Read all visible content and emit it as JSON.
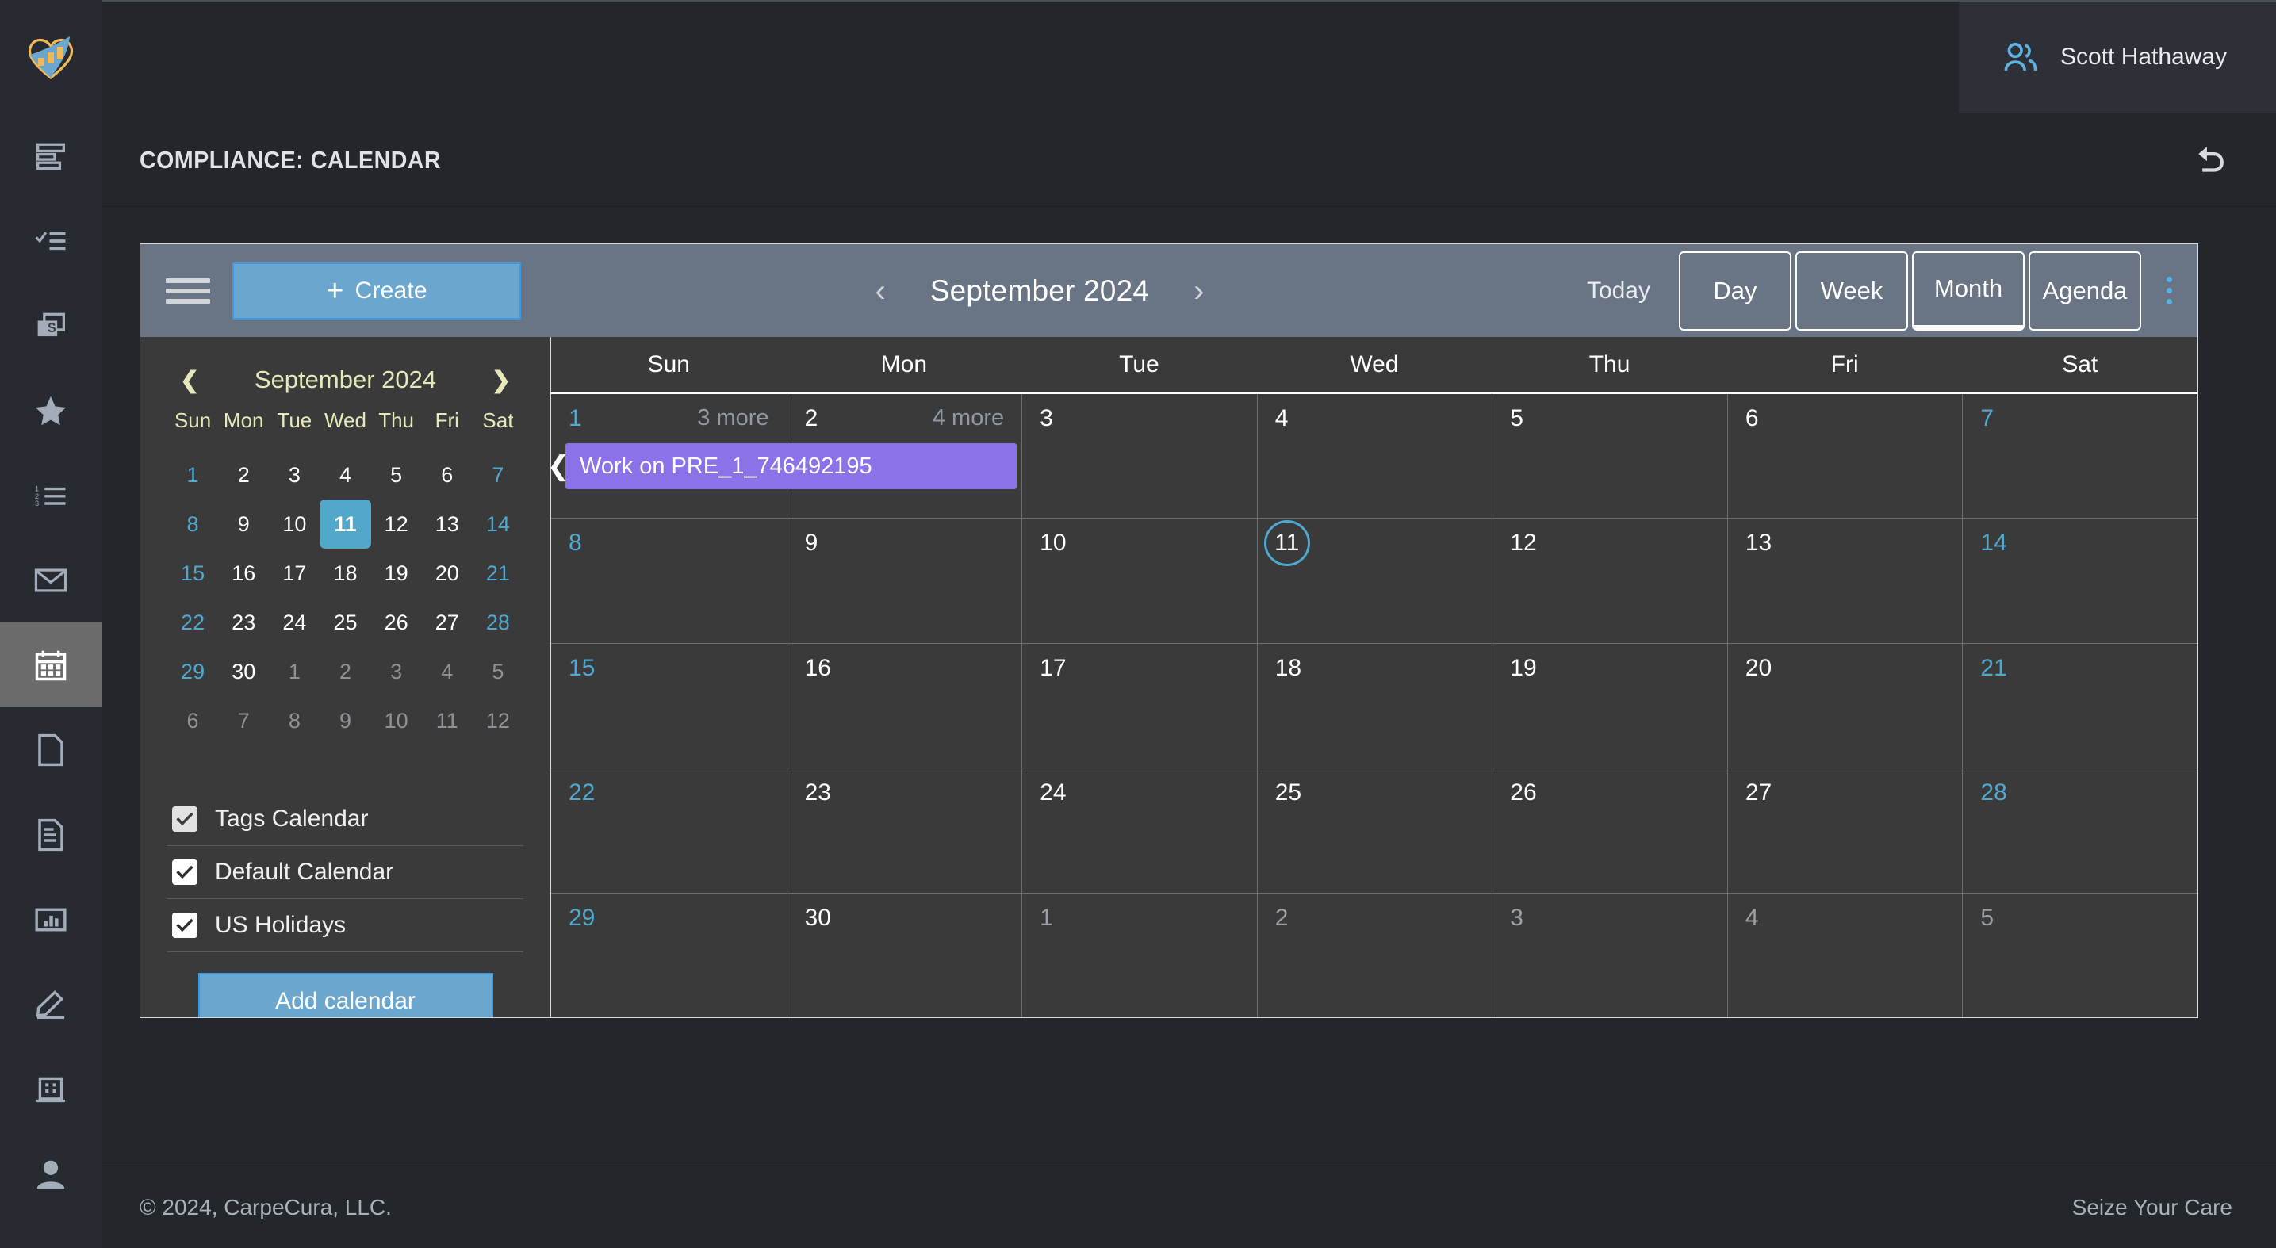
{
  "brand": {
    "logo_icon": "heart-chart-logo"
  },
  "sidebar": {
    "items": [
      {
        "icon": "align-left-icon",
        "name": "dashboard"
      },
      {
        "icon": "checklist-icon",
        "name": "tasks"
      },
      {
        "icon": "money-card-icon",
        "name": "billing"
      },
      {
        "icon": "star-icon",
        "name": "favorites"
      },
      {
        "icon": "numbered-list-icon",
        "name": "lists"
      },
      {
        "icon": "envelope-icon",
        "name": "messages"
      },
      {
        "icon": "calendar-icon",
        "name": "calendar"
      },
      {
        "icon": "blank-page-icon",
        "name": "new-document"
      },
      {
        "icon": "document-text-icon",
        "name": "documents"
      },
      {
        "icon": "chart-box-icon",
        "name": "reports"
      },
      {
        "icon": "pencil-icon",
        "name": "notes"
      },
      {
        "icon": "building-icon",
        "name": "organization"
      },
      {
        "icon": "person-icon",
        "name": "profile"
      }
    ]
  },
  "topbar": {
    "user_name": "Scott Hathaway",
    "user_icon": "users-icon"
  },
  "pagehead": {
    "title": "COMPLIANCE: CALENDAR",
    "undo_icon": "undo-arrow-icon"
  },
  "toolbar": {
    "menu_icon": "hamburger-icon",
    "create_label": "Create",
    "create_plus": "+",
    "prev_icon": "chevron-left-icon",
    "next_icon": "chevron-right-icon",
    "month_title": "September 2024",
    "today_label": "Today",
    "views": [
      {
        "label": "Day",
        "active": false
      },
      {
        "label": "Week",
        "active": false
      },
      {
        "label": "Month",
        "active": true
      },
      {
        "label": "Agenda",
        "active": false
      }
    ],
    "kebab_icon": "more-vertical-icon"
  },
  "mini_calendar": {
    "title": "September 2024",
    "prev_icon": "chevron-left-icon",
    "next_icon": "chevron-right-icon",
    "weekdays": [
      "Sun",
      "Mon",
      "Tue",
      "Wed",
      "Thu",
      "Fri",
      "Sat"
    ],
    "selected_day": 11,
    "weeks": [
      [
        {
          "d": "1",
          "t": "we"
        },
        {
          "d": "2",
          "t": ""
        },
        {
          "d": "3",
          "t": ""
        },
        {
          "d": "4",
          "t": ""
        },
        {
          "d": "5",
          "t": ""
        },
        {
          "d": "6",
          "t": ""
        },
        {
          "d": "7",
          "t": "we"
        }
      ],
      [
        {
          "d": "8",
          "t": "we"
        },
        {
          "d": "9",
          "t": ""
        },
        {
          "d": "10",
          "t": ""
        },
        {
          "d": "11",
          "t": "sel"
        },
        {
          "d": "12",
          "t": ""
        },
        {
          "d": "13",
          "t": ""
        },
        {
          "d": "14",
          "t": "we"
        }
      ],
      [
        {
          "d": "15",
          "t": "we"
        },
        {
          "d": "16",
          "t": ""
        },
        {
          "d": "17",
          "t": ""
        },
        {
          "d": "18",
          "t": ""
        },
        {
          "d": "19",
          "t": ""
        },
        {
          "d": "20",
          "t": ""
        },
        {
          "d": "21",
          "t": "we"
        }
      ],
      [
        {
          "d": "22",
          "t": "we"
        },
        {
          "d": "23",
          "t": ""
        },
        {
          "d": "24",
          "t": ""
        },
        {
          "d": "25",
          "t": ""
        },
        {
          "d": "26",
          "t": ""
        },
        {
          "d": "27",
          "t": ""
        },
        {
          "d": "28",
          "t": "we"
        }
      ],
      [
        {
          "d": "29",
          "t": "we"
        },
        {
          "d": "30",
          "t": ""
        },
        {
          "d": "1",
          "t": "out"
        },
        {
          "d": "2",
          "t": "out"
        },
        {
          "d": "3",
          "t": "out"
        },
        {
          "d": "4",
          "t": "out"
        },
        {
          "d": "5",
          "t": "out"
        }
      ],
      [
        {
          "d": "6",
          "t": "out"
        },
        {
          "d": "7",
          "t": "out"
        },
        {
          "d": "8",
          "t": "out"
        },
        {
          "d": "9",
          "t": "out"
        },
        {
          "d": "10",
          "t": "out"
        },
        {
          "d": "11",
          "t": "out"
        },
        {
          "d": "12",
          "t": "out"
        }
      ]
    ]
  },
  "calendars": {
    "items": [
      {
        "label": "Tags Calendar",
        "checked": true,
        "dim": true
      },
      {
        "label": "Default Calendar",
        "checked": true,
        "dim": false
      },
      {
        "label": "US Holidays",
        "checked": true,
        "dim": false
      }
    ],
    "add_label": "Add calendar"
  },
  "month_grid": {
    "weekdays": [
      "Sun",
      "Mon",
      "Tue",
      "Wed",
      "Thu",
      "Fri",
      "Sat"
    ],
    "today": 11,
    "weeks": [
      {
        "days": [
          {
            "n": "1",
            "t": "we",
            "more": "3 more"
          },
          {
            "n": "2",
            "t": "",
            "more": "4 more"
          },
          {
            "n": "3",
            "t": ""
          },
          {
            "n": "4",
            "t": ""
          },
          {
            "n": "5",
            "t": ""
          },
          {
            "n": "6",
            "t": ""
          },
          {
            "n": "7",
            "t": "we"
          }
        ],
        "events": [
          {
            "title": "Work on PRE_1_746492195",
            "start_col": 0,
            "span": 2,
            "color": "#8b72e8",
            "continues_left": true
          }
        ]
      },
      {
        "days": [
          {
            "n": "8",
            "t": "we"
          },
          {
            "n": "9",
            "t": ""
          },
          {
            "n": "10",
            "t": ""
          },
          {
            "n": "11",
            "t": "today"
          },
          {
            "n": "12",
            "t": ""
          },
          {
            "n": "13",
            "t": ""
          },
          {
            "n": "14",
            "t": "we"
          }
        ],
        "events": []
      },
      {
        "days": [
          {
            "n": "15",
            "t": "we"
          },
          {
            "n": "16",
            "t": ""
          },
          {
            "n": "17",
            "t": ""
          },
          {
            "n": "18",
            "t": ""
          },
          {
            "n": "19",
            "t": ""
          },
          {
            "n": "20",
            "t": ""
          },
          {
            "n": "21",
            "t": "we"
          }
        ],
        "events": []
      },
      {
        "days": [
          {
            "n": "22",
            "t": "we"
          },
          {
            "n": "23",
            "t": ""
          },
          {
            "n": "24",
            "t": ""
          },
          {
            "n": "25",
            "t": ""
          },
          {
            "n": "26",
            "t": ""
          },
          {
            "n": "27",
            "t": ""
          },
          {
            "n": "28",
            "t": "we"
          }
        ],
        "events": []
      },
      {
        "days": [
          {
            "n": "29",
            "t": "we"
          },
          {
            "n": "30",
            "t": ""
          },
          {
            "n": "1",
            "t": "out"
          },
          {
            "n": "2",
            "t": "out"
          },
          {
            "n": "3",
            "t": "out"
          },
          {
            "n": "4",
            "t": "out"
          },
          {
            "n": "5",
            "t": "out"
          }
        ],
        "events": []
      }
    ]
  },
  "footer": {
    "copyright": "© 2024, CarpeCura, LLC.",
    "tagline": "Seize Your Care"
  },
  "colors": {
    "accent_blue": "#53a7c8",
    "event_purple": "#8b72e8",
    "toolbar_slate": "#697585",
    "mini_head_khaki": "#e7e7b9",
    "rail_bg": "#272a30"
  }
}
